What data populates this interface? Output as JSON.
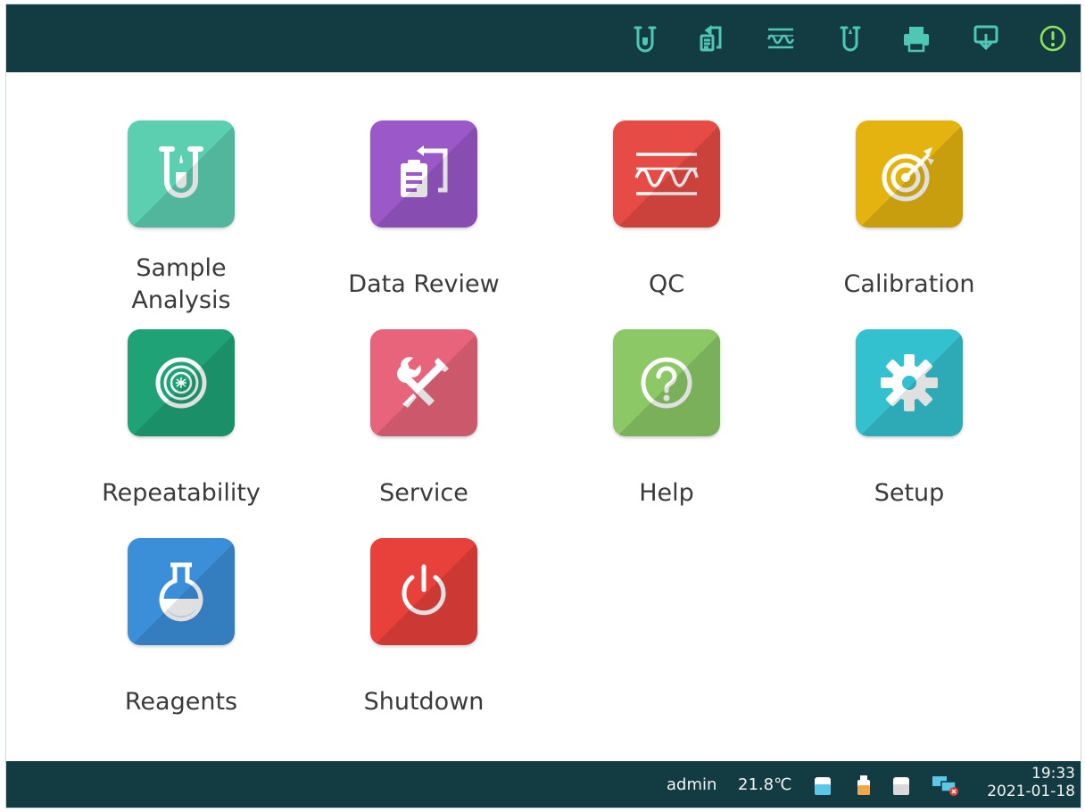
{
  "topbar": {
    "icons": [
      {
        "name": "sample-analysis-icon"
      },
      {
        "name": "data-review-icon"
      },
      {
        "name": "qc-icon"
      },
      {
        "name": "sample-tube-icon"
      },
      {
        "name": "printer-icon"
      },
      {
        "name": "network-icon"
      },
      {
        "name": "alert-icon"
      }
    ],
    "icon_color": "#4fc7b5",
    "alert_color": "#8fe35a"
  },
  "apps": [
    {
      "label": "Sample\nAnalysis",
      "icon": "test-tube-icon",
      "color": "#5ccfb0"
    },
    {
      "label": "Data Review",
      "icon": "clipboard-icon",
      "color": "#9b58c9"
    },
    {
      "label": "QC",
      "icon": "waveform-icon",
      "color": "#e74b45"
    },
    {
      "label": "Calibration",
      "icon": "target-icon",
      "color": "#e4b310"
    },
    {
      "label": "Repeatability",
      "icon": "concentric-rings-icon",
      "color": "#1fa376"
    },
    {
      "label": "Service",
      "icon": "wrench-screwdriver-icon",
      "color": "#e8647a"
    },
    {
      "label": "Help",
      "icon": "question-icon",
      "color": "#8cc866"
    },
    {
      "label": "Setup",
      "icon": "gear-icon",
      "color": "#33c1cf"
    },
    {
      "label": "Reagents",
      "icon": "flask-icon",
      "color": "#3b8ed8"
    },
    {
      "label": "Shutdown",
      "icon": "power-icon",
      "color": "#e8403a"
    }
  ],
  "status": {
    "user": "admin",
    "temperature": "21.8℃",
    "time": "19:33",
    "date": "2021-01-18",
    "reagent_colors": [
      "#5bc8e8",
      "#f0a64a",
      "#d9d9d9"
    ],
    "network_error_color": "#e8403a"
  }
}
